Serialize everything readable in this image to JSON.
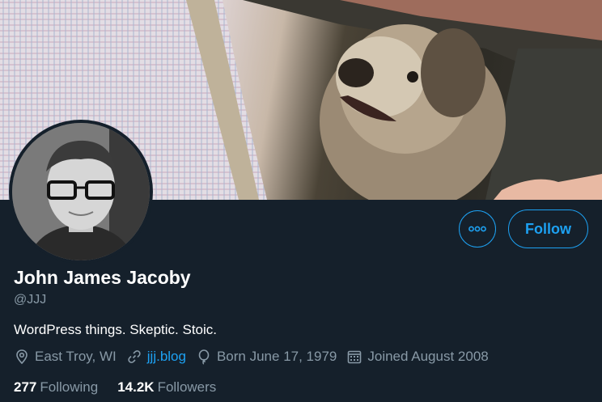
{
  "profile": {
    "name": "John James Jacoby",
    "handle": "@JJJ",
    "bio": "WordPress things. Skeptic. Stoic.",
    "location": "East Troy, WI",
    "website": "jjj.blog",
    "birthday": "Born June 17, 1979",
    "joined": "Joined August 2008"
  },
  "actions": {
    "follow_label": "Follow",
    "more_icon": "more-options-icon"
  },
  "stats": {
    "following_count": "277",
    "following_label": "Following",
    "followers_count": "14.2K",
    "followers_label": "Followers"
  },
  "icons": {
    "location": "location-pin-icon",
    "link": "link-icon",
    "birthday": "balloon-icon",
    "joined": "calendar-icon"
  },
  "colors": {
    "background": "#15202b",
    "accent": "#1da1f2",
    "secondary_text": "#8899a6"
  }
}
